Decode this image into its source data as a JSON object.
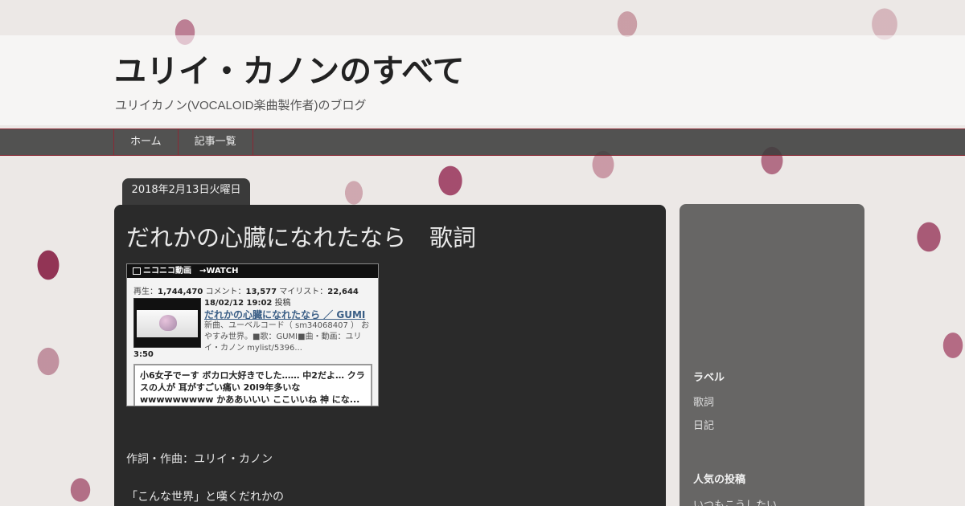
{
  "blog": {
    "title": "ユリイ・カノンのすべて",
    "description": "ユリイカノン(VOCALOID楽曲製作者)のブログ"
  },
  "nav": {
    "items": [
      {
        "label": "ホーム"
      },
      {
        "label": "記事一覧"
      }
    ]
  },
  "post": {
    "date": "2018年2月13日火曜日",
    "title": "だれかの心臓になれたなら　歌詞",
    "credits": "作詞・作曲：ユリイ・カノン",
    "first_line": "「こんな世界」と嘆くだれかの"
  },
  "nico": {
    "brand": "ニコニコ動画",
    "watch": "→WATCH",
    "views_label": "再生：",
    "views": "1,744,470",
    "comments_label": "コメント：",
    "comments": "13,577",
    "mylist_label": "マイリスト：",
    "mylist": "22,644",
    "posted_date": "18/02/12 19:02",
    "posted_label": "投稿",
    "video_title": "だれかの心臓になれたなら ／ GUMI",
    "description": "新曲、ユーベルコード（ sm34068407 ） おやすみ世界。■歌：GUMI■曲・動画：ユリイ・カノン mylist/5396...",
    "duration": "3:50",
    "comment_text": "小6女子でーす ボカロ大好きでした…… 中2だよ… クラスの人が 耳がすごい痛い 20l9年多いな wwwwwwwww かああいいい ここいいね 神 にな..."
  },
  "sidebar": {
    "labels_heading": "ラベル",
    "labels": [
      {
        "label": "歌詞"
      },
      {
        "label": "日記"
      }
    ],
    "popular_heading": "人気の投稿",
    "popular_first": "いつもこうしたい"
  },
  "colors": {
    "nav_bg": "#3c3c3c",
    "nav_border": "#8a2a35",
    "panel_bg": "#2a2a2a",
    "link": "#3a5e86"
  }
}
